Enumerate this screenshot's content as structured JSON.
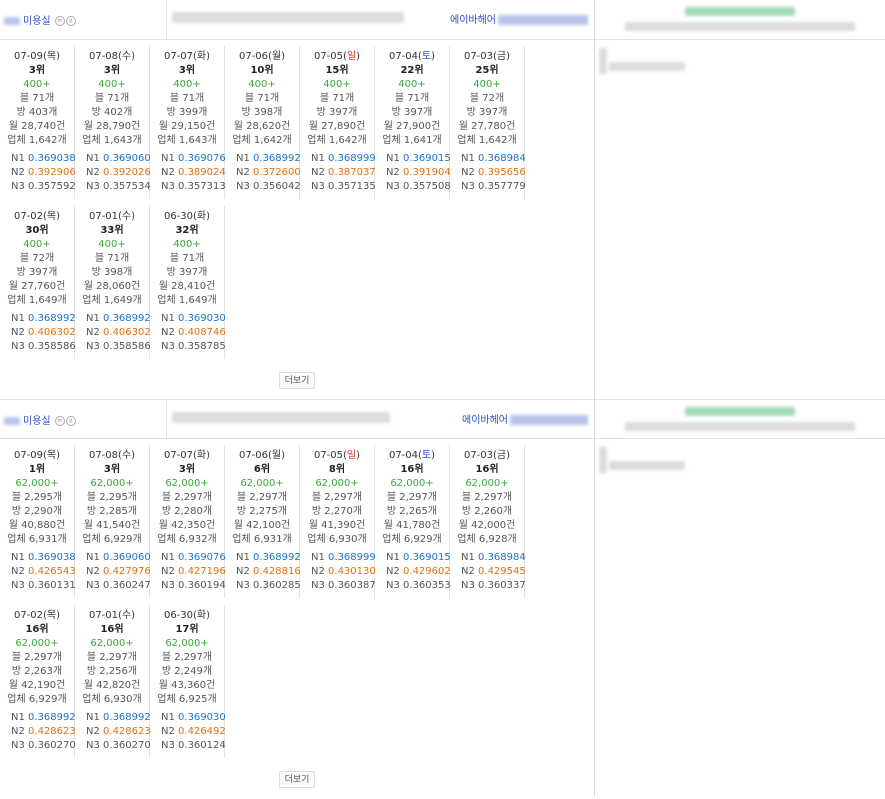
{
  "more_label": "더보기",
  "sections": [
    {
      "category": "미용실",
      "owner": "에이바헤어",
      "cards": [
        {
          "md": "07-09(",
          "wd": "목",
          "wt": "",
          "tail": ")",
          "rank": "3위",
          "plus": "400+",
          "blog": "블 71개",
          "visit": "방 403개",
          "month": "월 28,740건",
          "biz": "업체 1,642개",
          "n1": "0.369038",
          "n2": "0.392906",
          "n3": "0.357592"
        },
        {
          "md": "07-08(",
          "wd": "수",
          "wt": "",
          "tail": ")",
          "rank": "3위",
          "plus": "400+",
          "blog": "블 71개",
          "visit": "방 402개",
          "month": "월 28,790건",
          "biz": "업체 1,643개",
          "n1": "0.369060",
          "n2": "0.392026",
          "n3": "0.357534"
        },
        {
          "md": "07-07(",
          "wd": "화",
          "wt": "",
          "tail": ")",
          "rank": "3위",
          "plus": "400+",
          "blog": "블 71개",
          "visit": "방 399개",
          "month": "월 29,150건",
          "biz": "업체 1,643개",
          "n1": "0.369076",
          "n2": "0.389024",
          "n3": "0.357313"
        },
        {
          "md": "07-06(",
          "wd": "월",
          "wt": "",
          "tail": ")",
          "rank": "10위",
          "plus": "400+",
          "blog": "블 71개",
          "visit": "방 398개",
          "month": "월 28,620건",
          "biz": "업체 1,642개",
          "n1": "0.368992",
          "n2": "0.372600",
          "n3": "0.356042"
        },
        {
          "md": "07-05(",
          "wd": "일",
          "wt": "sun",
          "tail": ")",
          "rank": "15위",
          "plus": "400+",
          "blog": "블 71개",
          "visit": "방 397개",
          "month": "월 27,890건",
          "biz": "업체 1,642개",
          "n1": "0.368999",
          "n2": "0.387037",
          "n3": "0.357135"
        },
        {
          "md": "07-04(",
          "wd": "토",
          "wt": "sat",
          "tail": ")",
          "rank": "22위",
          "plus": "400+",
          "blog": "블 71개",
          "visit": "방 397개",
          "month": "월 27,900건",
          "biz": "업체 1,641개",
          "n1": "0.369015",
          "n2": "0.391904",
          "n3": "0.357508"
        },
        {
          "md": "07-03(",
          "wd": "금",
          "wt": "",
          "tail": ")",
          "rank": "25위",
          "plus": "400+",
          "blog": "블 72개",
          "visit": "방 397개",
          "month": "월 27,780건",
          "biz": "업체 1,642개",
          "n1": "0.368984",
          "n2": "0.395656",
          "n3": "0.357779"
        },
        {
          "md": "07-02(",
          "wd": "목",
          "wt": "",
          "tail": ")",
          "rank": "30위",
          "plus": "400+",
          "blog": "블 72개",
          "visit": "방 397개",
          "month": "월 27,760건",
          "biz": "업체 1,649개",
          "n1": "0.368992",
          "n2": "0.406302",
          "n3": "0.358586"
        },
        {
          "md": "07-01(",
          "wd": "수",
          "wt": "",
          "tail": ")",
          "rank": "33위",
          "plus": "400+",
          "blog": "블 71개",
          "visit": "방 398개",
          "month": "월 28,060건",
          "biz": "업체 1,649개",
          "n1": "0.368992",
          "n2": "0.406302",
          "n3": "0.358586"
        },
        {
          "md": "06-30(",
          "wd": "화",
          "wt": "",
          "tail": ")",
          "rank": "32위",
          "plus": "400+",
          "blog": "블 71개",
          "visit": "방 397개",
          "month": "월 28,410건",
          "biz": "업체 1,649개",
          "n1": "0.369030",
          "n2": "0.408746",
          "n3": "0.358785"
        }
      ]
    },
    {
      "category": "미용실",
      "owner": "에이바헤어",
      "cards": [
        {
          "md": "07-09(",
          "wd": "목",
          "wt": "",
          "tail": ")",
          "rank": "1위",
          "plus": "62,000+",
          "blog": "블 2,295개",
          "visit": "방 2,290개",
          "month": "월 40,880건",
          "biz": "업체 6,931개",
          "n1": "0.369038",
          "n2": "0.426543",
          "n3": "0.360131"
        },
        {
          "md": "07-08(",
          "wd": "수",
          "wt": "",
          "tail": ")",
          "rank": "3위",
          "plus": "62,000+",
          "blog": "블 2,295개",
          "visit": "방 2,285개",
          "month": "월 41,540건",
          "biz": "업체 6,929개",
          "n1": "0.369060",
          "n2": "0.427976",
          "n3": "0.360247"
        },
        {
          "md": "07-07(",
          "wd": "화",
          "wt": "",
          "tail": ")",
          "rank": "3위",
          "plus": "62,000+",
          "blog": "블 2,297개",
          "visit": "방 2,280개",
          "month": "월 42,350건",
          "biz": "업체 6,932개",
          "n1": "0.369076",
          "n2": "0.427196",
          "n3": "0.360194"
        },
        {
          "md": "07-06(",
          "wd": "월",
          "wt": "",
          "tail": ")",
          "rank": "6위",
          "plus": "62,000+",
          "blog": "블 2,297개",
          "visit": "방 2,275개",
          "month": "월 42,100건",
          "biz": "업체 6,931개",
          "n1": "0.368992",
          "n2": "0.428816",
          "n3": "0.360285"
        },
        {
          "md": "07-05(",
          "wd": "일",
          "wt": "sun",
          "tail": ")",
          "rank": "8위",
          "plus": "62,000+",
          "blog": "블 2,297개",
          "visit": "방 2,270개",
          "month": "월 41,390건",
          "biz": "업체 6,930개",
          "n1": "0.368999",
          "n2": "0.430130",
          "n3": "0.360387"
        },
        {
          "md": "07-04(",
          "wd": "토",
          "wt": "sat",
          "tail": ")",
          "rank": "16위",
          "plus": "62,000+",
          "blog": "블 2,297개",
          "visit": "방 2,265개",
          "month": "월 41,780건",
          "biz": "업체 6,929개",
          "n1": "0.369015",
          "n2": "0.429602",
          "n3": "0.360353"
        },
        {
          "md": "07-03(",
          "wd": "금",
          "wt": "",
          "tail": ")",
          "rank": "16위",
          "plus": "62,000+",
          "blog": "블 2,297개",
          "visit": "방 2,260개",
          "month": "월 42,000건",
          "biz": "업체 6,928개",
          "n1": "0.368984",
          "n2": "0.429545",
          "n3": "0.360337"
        },
        {
          "md": "07-02(",
          "wd": "목",
          "wt": "",
          "tail": ")",
          "rank": "16위",
          "plus": "62,000+",
          "blog": "블 2,297개",
          "visit": "방 2,263개",
          "month": "월 42,190건",
          "biz": "업체 6,929개",
          "n1": "0.368992",
          "n2": "0.428623",
          "n3": "0.360270"
        },
        {
          "md": "07-01(",
          "wd": "수",
          "wt": "",
          "tail": ")",
          "rank": "16위",
          "plus": "62,000+",
          "blog": "블 2,297개",
          "visit": "방 2,256개",
          "month": "월 42,820건",
          "biz": "업체 6,930개",
          "n1": "0.368992",
          "n2": "0.428623",
          "n3": "0.360270"
        },
        {
          "md": "06-30(",
          "wd": "화",
          "wt": "",
          "tail": ")",
          "rank": "17위",
          "plus": "62,000+",
          "blog": "블 2,297개",
          "visit": "방 2,249개",
          "month": "월 43,360건",
          "biz": "업체 6,925개",
          "n1": "0.369030",
          "n2": "0.426492",
          "n3": "0.360124"
        }
      ]
    }
  ]
}
